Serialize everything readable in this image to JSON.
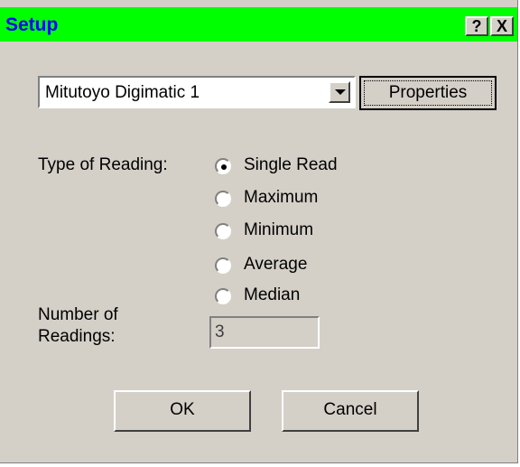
{
  "window": {
    "title": "Setup",
    "help_label": "?",
    "close_label": "X"
  },
  "device": {
    "selected": "Mitutoyo Digimatic 1",
    "properties_label": "Properties"
  },
  "reading": {
    "type_label": "Type of Reading:",
    "options": [
      "Single Read",
      "Maximum",
      "Minimum",
      "Average",
      "Median"
    ],
    "selected": "Single Read",
    "count_label_line1": "Number of",
    "count_label_line2": "Readings:",
    "count_value": "3"
  },
  "actions": {
    "ok_label": "OK",
    "cancel_label": "Cancel"
  },
  "colors": {
    "titlebar": "#00ff00",
    "title_text": "#0000ff",
    "dialog_bg": "#d4d0c8"
  }
}
